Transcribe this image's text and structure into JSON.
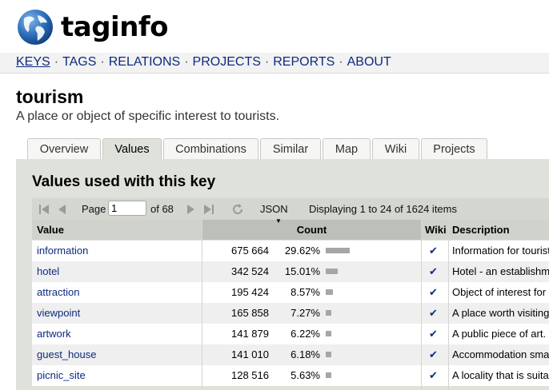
{
  "header": {
    "logo_text": "taginfo",
    "nav": [
      {
        "label": "KEYS",
        "active": true
      },
      {
        "label": "TAGS"
      },
      {
        "label": "RELATIONS"
      },
      {
        "label": "PROJECTS"
      },
      {
        "label": "REPORTS"
      },
      {
        "label": "ABOUT"
      }
    ],
    "nav_separator": "·"
  },
  "key": {
    "title": "tourism",
    "description": "A place or object of specific interest to tourists."
  },
  "tabs": [
    {
      "label": "Overview"
    },
    {
      "label": "Values",
      "active": true
    },
    {
      "label": "Combinations"
    },
    {
      "label": "Similar"
    },
    {
      "label": "Map"
    },
    {
      "label": "Wiki"
    },
    {
      "label": "Projects"
    }
  ],
  "panel": {
    "title": "Values used with this key",
    "pager": {
      "page_label": "Page",
      "page_value": "1",
      "of_label": "of 68",
      "json_label": "JSON",
      "displaying": "Displaying 1 to 24 of 1624 items"
    },
    "columns": {
      "value": "Value",
      "count": "Count",
      "wiki": "Wiki",
      "description": "Description"
    },
    "rows": [
      {
        "value": "information",
        "count": "675 664",
        "percent": "29.62%",
        "fraction": 0.2962,
        "wiki": "✔",
        "description": "Information for tourists"
      },
      {
        "value": "hotel",
        "count": "342 524",
        "percent": "15.01%",
        "fraction": 0.1501,
        "wiki": "✔",
        "description": "Hotel - an establishment"
      },
      {
        "value": "attraction",
        "count": "195 424",
        "percent": "8.57%",
        "fraction": 0.0857,
        "wiki": "✔",
        "description": "Object of interest for a"
      },
      {
        "value": "viewpoint",
        "count": "165 858",
        "percent": "7.27%",
        "fraction": 0.0727,
        "wiki": "✔",
        "description": "A place worth visiting"
      },
      {
        "value": "artwork",
        "count": "141 879",
        "percent": "6.22%",
        "fraction": 0.0622,
        "wiki": "✔",
        "description": "A public piece of art."
      },
      {
        "value": "guest_house",
        "count": "141 010",
        "percent": "6.18%",
        "fraction": 0.0618,
        "wiki": "✔",
        "description": "Accommodation small"
      },
      {
        "value": "picnic_site",
        "count": "128 516",
        "percent": "5.63%",
        "fraction": 0.0563,
        "wiki": "✔",
        "description": "A locality that is suitable"
      }
    ]
  },
  "colors": {
    "link": "#0c2a80",
    "panel": "#dfe1db",
    "bar": "#a6a6a6"
  }
}
